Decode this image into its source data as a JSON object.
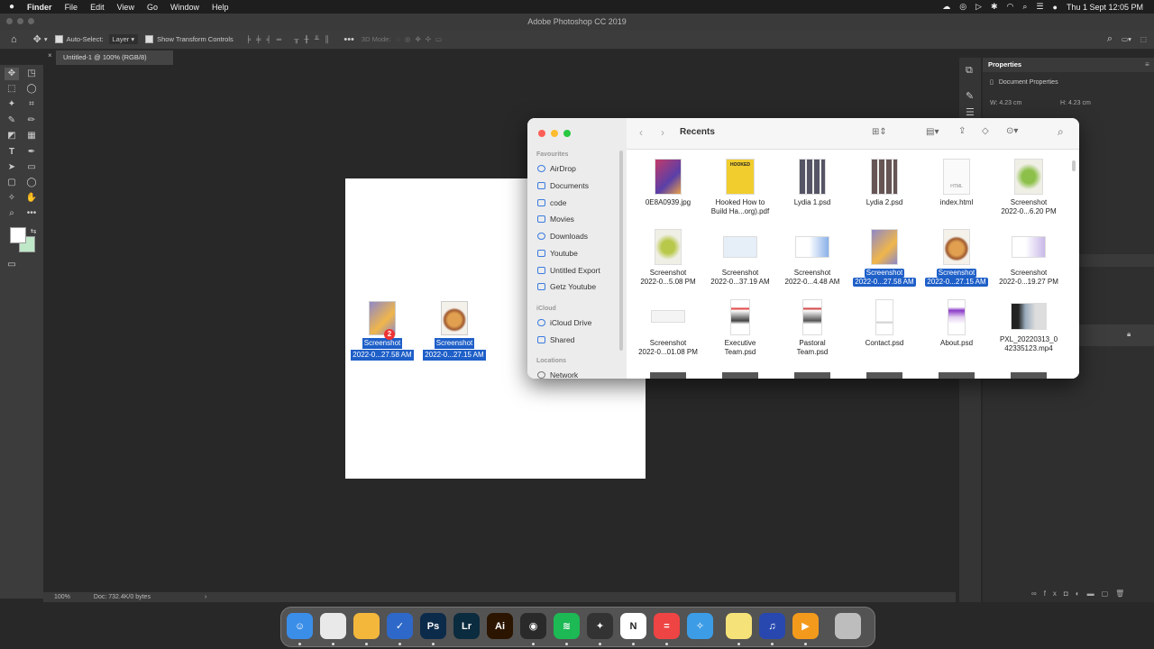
{
  "menubar": {
    "app": "Finder",
    "items": [
      "File",
      "Edit",
      "View",
      "Go",
      "Window",
      "Help"
    ],
    "clock": "Thu 1 Sept  12:05 PM"
  },
  "photoshop": {
    "window_title": "Adobe Photoshop CC 2019",
    "options": {
      "auto_select_label": "Auto-Select:",
      "auto_select_value": "Layer",
      "show_transform_label": "Show Transform Controls",
      "three_d_mode_label": "3D Mode:"
    },
    "doc_tab": "Untitled-1 @ 100% (RGB/8)",
    "status": {
      "zoom": "100%",
      "doc": "Doc: 732.4K/0 bytes"
    },
    "properties": {
      "title": "Properties",
      "section": "Document Properties",
      "width": "W: 4.23 cm",
      "height": "H: 4.23 cm"
    }
  },
  "canvas_items": [
    {
      "label1": "Screenshot",
      "label2": "2022-0...27.58 AM",
      "badge": "2"
    },
    {
      "label1": "Screenshot",
      "label2": "2022-0...27.15 AM"
    }
  ],
  "finder": {
    "title": "Recents",
    "sidebar": {
      "favourites_header": "Favourites",
      "favourites": [
        "AirDrop",
        "Documents",
        "code",
        "Movies",
        "Downloads",
        "Youtube",
        "Untitled Export",
        "Getz Youtube"
      ],
      "icloud_header": "iCloud",
      "icloud": [
        "iCloud Drive",
        "Shared"
      ],
      "locations_header": "Locations",
      "locations": [
        "Network"
      ]
    },
    "files": [
      {
        "l1": "0E8A0939.jpg",
        "l2": ""
      },
      {
        "l1": "Hooked How to",
        "l2": "Build Ha...org).pdf"
      },
      {
        "l1": "Lydia 1.psd",
        "l2": ""
      },
      {
        "l1": "Lydia 2.psd",
        "l2": ""
      },
      {
        "l1": "index.html",
        "l2": ""
      },
      {
        "l1": "Screenshot",
        "l2": "2022-0...6.20 PM"
      },
      {
        "l1": "Screenshot",
        "l2": "2022-0...5.08 PM"
      },
      {
        "l1": "Screenshot",
        "l2": "2022-0...37.19 AM"
      },
      {
        "l1": "Screenshot",
        "l2": "2022-0...4.48 AM"
      },
      {
        "l1": "Screenshot",
        "l2": "2022-0...27.58 AM"
      },
      {
        "l1": "Screenshot",
        "l2": "2022-0...27.15 AM"
      },
      {
        "l1": "Screenshot",
        "l2": "2022-0...19.27 PM"
      },
      {
        "l1": "Screenshot",
        "l2": "2022-0...01.08 PM"
      },
      {
        "l1": "Executive",
        "l2": "Team.psd"
      },
      {
        "l1": "Pastoral",
        "l2": "Team.psd"
      },
      {
        "l1": "Contact.psd",
        "l2": ""
      },
      {
        "l1": "About.psd",
        "l2": ""
      },
      {
        "l1": "PXL_20220313_0",
        "l2": "42335123.mp4"
      }
    ],
    "html_badge": "HTML",
    "book_cover_text": "HOOKED"
  },
  "dock": {
    "apps": [
      {
        "name": "finder-icon",
        "color": "#3b8ee8",
        "glyph": "☺"
      },
      {
        "name": "chrome-icon",
        "color": "#e9e9e9",
        "glyph": ""
      },
      {
        "name": "notes-circle-icon",
        "color": "#f3b73c",
        "glyph": ""
      },
      {
        "name": "todo-icon",
        "color": "#2e69c9",
        "glyph": "✓"
      },
      {
        "name": "photoshop-icon",
        "color": "#0c2a4a",
        "glyph": "Ps"
      },
      {
        "name": "lightroom-icon",
        "color": "#0b2b3e",
        "glyph": "Lr"
      },
      {
        "name": "illustrator-icon",
        "color": "#2b1500",
        "glyph": "Ai"
      },
      {
        "name": "davinci-icon",
        "color": "#2a2a2a",
        "glyph": "◉"
      },
      {
        "name": "spotify-icon",
        "color": "#1db954",
        "glyph": "≋"
      },
      {
        "name": "final-cut-icon",
        "color": "#333",
        "glyph": "✦"
      },
      {
        "name": "notion-icon",
        "color": "#fff",
        "glyph": "N"
      },
      {
        "name": "todoist-icon",
        "color": "#e44",
        "glyph": "="
      },
      {
        "name": "safari-icon",
        "color": "#3c9de6",
        "glyph": "✧"
      },
      {
        "name": "notes-icon",
        "color": "#f5e37a",
        "glyph": ""
      },
      {
        "name": "audio-icon",
        "color": "#2848b0",
        "glyph": "♫"
      },
      {
        "name": "infuse-icon",
        "color": "#f39a1c",
        "glyph": "▶"
      },
      {
        "name": "trash-icon",
        "color": "#bdbdbd",
        "glyph": ""
      }
    ]
  }
}
